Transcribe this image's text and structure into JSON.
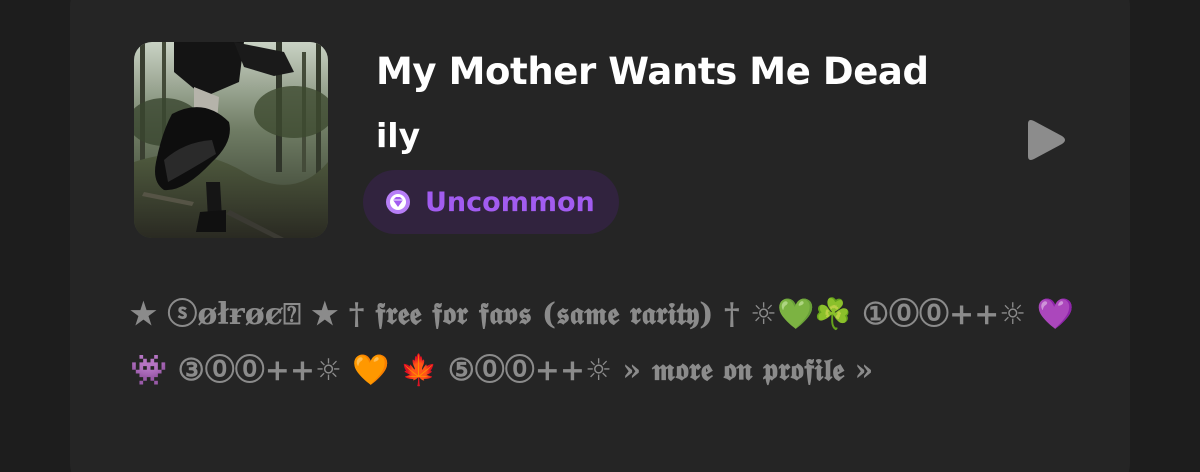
{
  "track": {
    "title": "My Mother Wants Me Dead",
    "artist": "ily",
    "rarity": "Uncommon",
    "description": "★ ⓢøłɍøȼ⍰ ★ † 𝖋𝖗𝖊𝖊 𝖋𝖔𝖗 𝖋𝖆𝖛𝖘 (𝖘𝖆𝖒𝖊 𝖗𝖆𝖗𝖎𝖙𝖞) † ☼💚☘️ ①⓪⓪++☼ 💜 👾 ③⓪⓪++☼ 🧡 🍁 ⑤⓪⓪++☼ » 𝖒𝖔𝖗𝖊 𝖔𝖓 𝖕𝖗𝖔𝖋𝖎𝖑𝖊 »"
  },
  "icons": {
    "rarity": "gem-icon",
    "play": "play-icon",
    "cover": "album-cover-image"
  },
  "colors": {
    "background": "#1d1d1d",
    "card": "#252525",
    "rarity_pill": "#31233e",
    "rarity_accent": "#a25cf0",
    "description_text": "#8b8b8b",
    "play_icon": "#8c8c8c"
  }
}
